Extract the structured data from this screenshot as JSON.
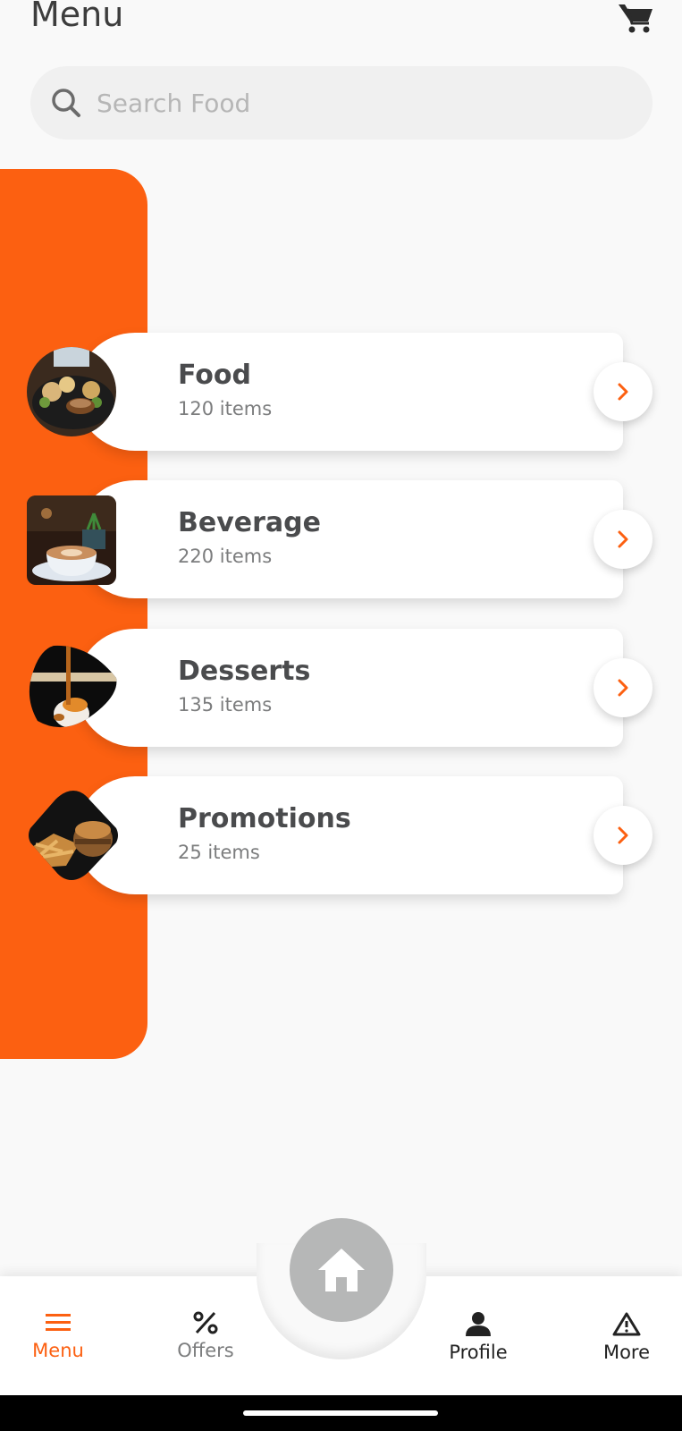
{
  "header": {
    "title": "Menu",
    "cart_icon": "cart-icon"
  },
  "search": {
    "placeholder": "Search Food",
    "value": "",
    "icon": "search-icon"
  },
  "categories": [
    {
      "name": "Food",
      "count": "120 items",
      "image": "food-plate-photo"
    },
    {
      "name": "Beverage",
      "count": "220 items",
      "image": "coffee-cup-photo"
    },
    {
      "name": "Desserts",
      "count": "135 items",
      "image": "dessert-photo"
    },
    {
      "name": "Promotions",
      "count": "25 items",
      "image": "burger-fries-photo"
    }
  ],
  "bottom_nav": {
    "items": [
      {
        "label": "Menu",
        "icon": "hamburger-icon",
        "active": true
      },
      {
        "label": "Offers",
        "icon": "percent-icon",
        "active": false
      },
      {
        "label": "Profile",
        "icon": "person-icon",
        "active": false
      },
      {
        "label": "More",
        "icon": "warning-triangle-icon",
        "active": false
      }
    ],
    "home_icon": "home-icon"
  },
  "colors": {
    "accent": "#fc6011",
    "text_primary": "#4a4b4d",
    "text_secondary": "#7c7d7e",
    "inactive_nav": "#7c7d7e",
    "home_button": "#b6b7b7",
    "background": "#f9f9f9"
  }
}
